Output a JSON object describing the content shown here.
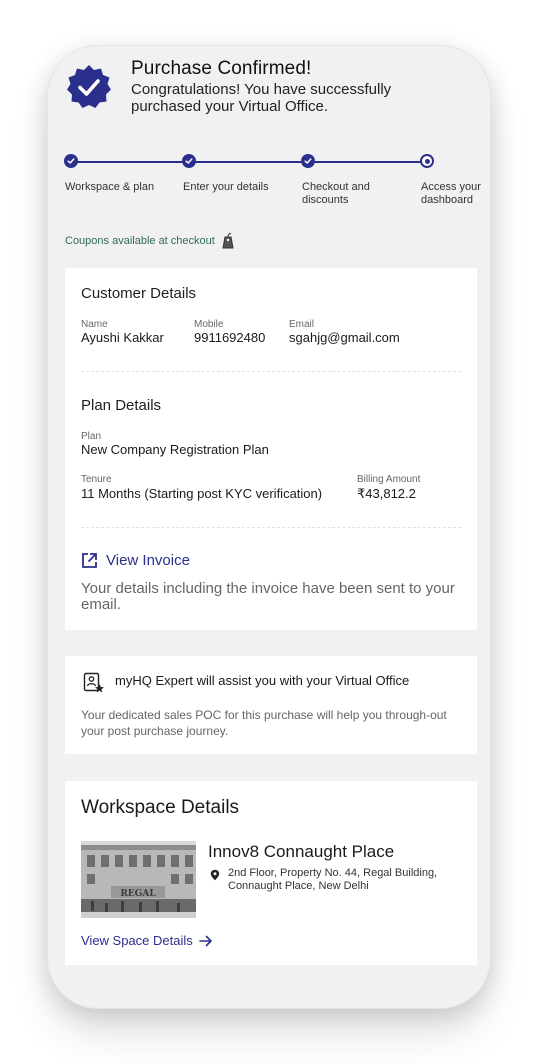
{
  "header": {
    "title": "Purchase Confirmed!",
    "subtitle": "Congratulations! You have successfully purchased your Virtual Office."
  },
  "stepper": {
    "steps": [
      {
        "label": "Workspace & plan",
        "state": "done"
      },
      {
        "label": "Enter your details",
        "state": "done"
      },
      {
        "label": "Checkout and discounts",
        "state": "done"
      },
      {
        "label": "Access your dashboard",
        "state": "current"
      }
    ],
    "accent": "#2b2f8c"
  },
  "coupon": {
    "text": "Coupons available at checkout",
    "icon": "tag-icon"
  },
  "customer": {
    "title": "Customer Details",
    "name_label": "Name",
    "name": "Ayushi Kakkar",
    "mobile_label": "Mobile",
    "mobile": "9911692480",
    "email_label": "Email",
    "email": "sgahjg@gmail.com"
  },
  "plan": {
    "title": "Plan Details",
    "plan_label": "Plan",
    "plan": "New Company Registration Plan",
    "tenure_label": "Tenure",
    "tenure": "11 Months (Starting post KYC verification)",
    "amount_label": "Billing Amount",
    "amount": "₹43,812.2"
  },
  "invoice": {
    "link": "View Invoice",
    "note": "Your details including the invoice have been sent to your email."
  },
  "expert": {
    "title": "myHQ Expert will assist you with your Virtual Office",
    "desc": "Your dedicated sales POC for this purchase will help you through-out your post purchase journey."
  },
  "workspace": {
    "title": "Workspace Details",
    "name": "Innov8 Connaught Place",
    "address": "2nd Floor, Property No. 44, Regal Building, Connaught Place, New Delhi",
    "photo_sign": "REGAL",
    "link": "View Space Details"
  }
}
